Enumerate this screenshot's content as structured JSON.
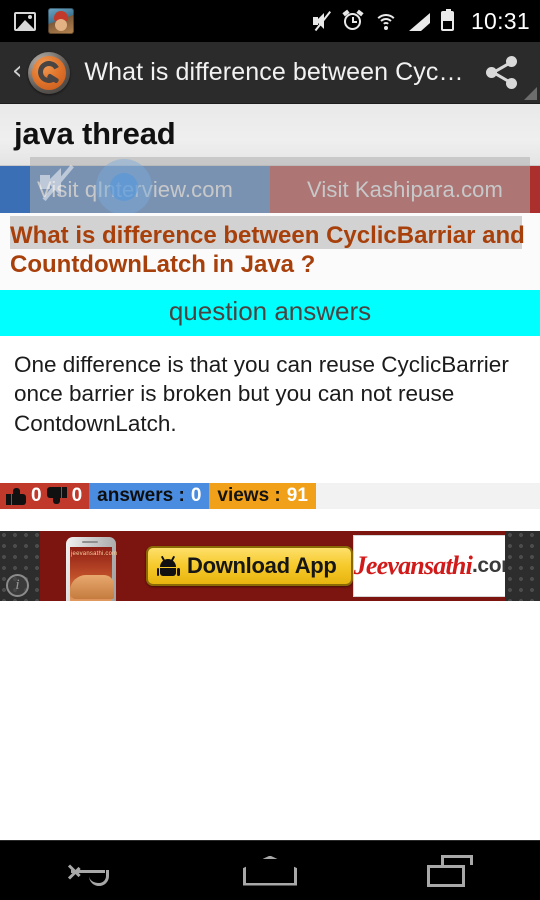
{
  "statusbar": {
    "time": "10:31",
    "icons": [
      "gallery-icon",
      "app-notification-icon",
      "mute-icon",
      "alarm-icon",
      "wifi-icon",
      "signal-icon",
      "battery-icon"
    ]
  },
  "actionbar": {
    "back_label": "‹",
    "logo_name": "app-logo-icon",
    "title": "What is difference between Cyc…",
    "share_label": "share-icon"
  },
  "page": {
    "title": "java thread",
    "links": [
      {
        "label": "Visit qInterview.com",
        "color": "#3b6fb5"
      },
      {
        "label": "Visit Kashipara.com",
        "color": "#ab2f2c"
      }
    ],
    "question": "What is difference between CyclicBarriar and CountdownLatch in Java ?",
    "question_color": "#a8400b",
    "section_band": {
      "label": "question answers",
      "background": "#00ffff",
      "text_color": "#4a4340"
    },
    "answer": "One difference is that you can reuse CyclicBarrier once barrier is broken but you can not reuse ContdownLatch.",
    "stats": {
      "upvotes": "0",
      "downvotes": "0",
      "answers_label": "answers :",
      "answers_count": "0",
      "views_label": "views :",
      "views_count": "91",
      "votes_color": "#c0392b",
      "answers_color": "#4a8ce0",
      "views_color": "#f0a119"
    }
  },
  "ad": {
    "info_label": "i",
    "phone_screen_text": "jeevansathi.com",
    "cta_label": "Download App",
    "cta_icon": "android-icon",
    "brand": "Jeevansathi",
    "brand_tld": ".com"
  },
  "navbar": {
    "back": "back-nav-button",
    "home": "home-nav-button",
    "recents": "recents-nav-button"
  }
}
